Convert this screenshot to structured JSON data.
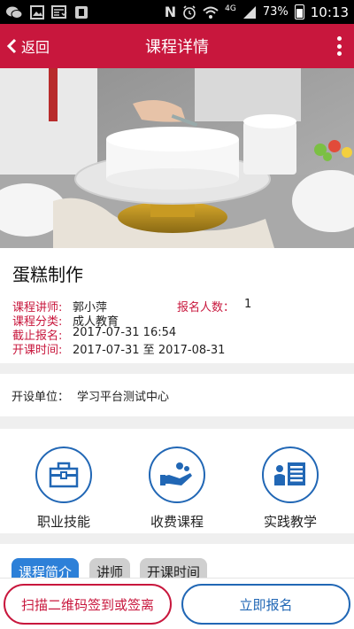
{
  "status_bar": {
    "network": "4G",
    "battery": "73%",
    "time": "10:13",
    "icons": [
      "wechat-icon",
      "gallery-icon",
      "news-icon",
      "app-icon",
      "nfc-icon",
      "alarm-icon",
      "wifi-icon",
      "signal-icon",
      "battery-icon"
    ]
  },
  "header": {
    "back_label": "返回",
    "title": "课程详情",
    "more_icon": "more-vertical-icon"
  },
  "hero": {
    "image": "cake-decorating-photo"
  },
  "course": {
    "title": "蛋糕制作",
    "teacher_label": "课程讲师:",
    "teacher": "郭小萍",
    "enroll_count_label": "报名人数：",
    "enroll_count": "1",
    "category_label": "课程分类:",
    "category": "成人教育",
    "deadline_label": "截止报名:",
    "deadline": "2017-07-31 16:54",
    "period_label": "开课时间:",
    "period": "2017-07-31 至 2017-08-31"
  },
  "organizer": {
    "label": "开设单位：",
    "value": "学习平台测试中心"
  },
  "categories": [
    {
      "label": "职业技能",
      "icon": "toolbox-icon"
    },
    {
      "label": "收费课程",
      "icon": "hand-money-icon"
    },
    {
      "label": "实践教学",
      "icon": "teacher-board-icon"
    }
  ],
  "tabs": [
    {
      "label": "课程简介",
      "active": true
    },
    {
      "label": "讲师",
      "active": false
    },
    {
      "label": "开课时间",
      "active": false
    }
  ],
  "actions": {
    "scan_label": "扫描二维码签到或签离",
    "enroll_label": "立即报名"
  },
  "colors": {
    "brand_red": "#c8173d",
    "brand_blue": "#2167b5",
    "tab_active": "#2d80d8"
  }
}
